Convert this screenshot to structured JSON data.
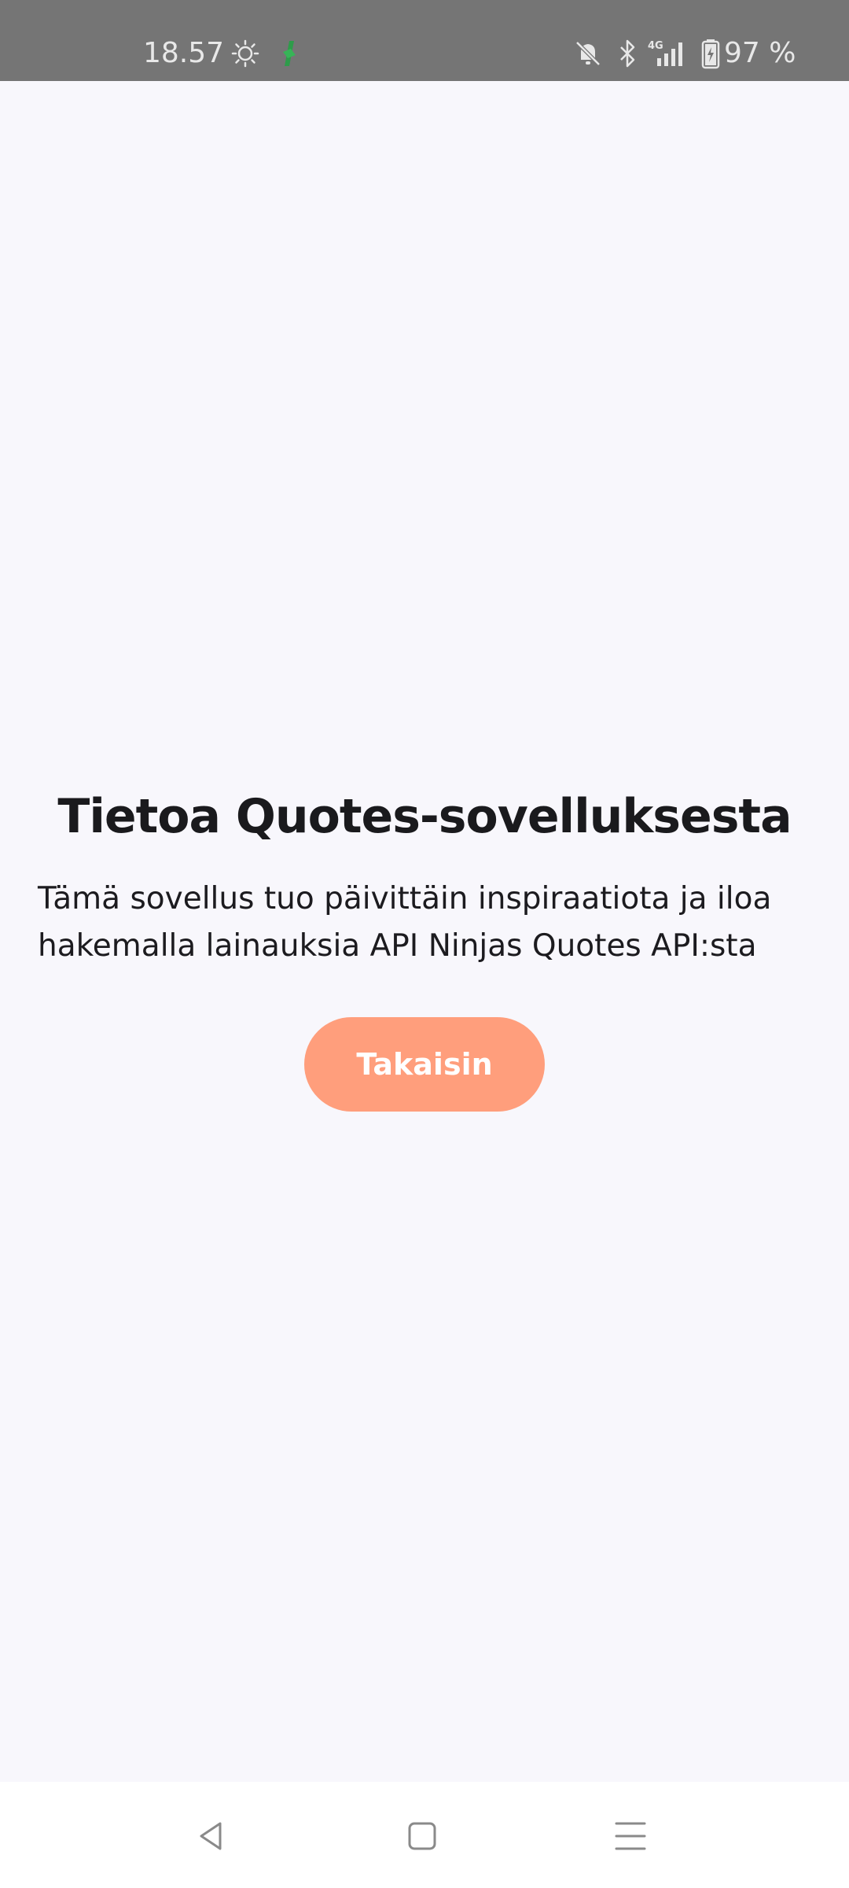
{
  "status_bar": {
    "time": "18.57",
    "battery_text": "97 %",
    "icons": [
      "brightness-icon",
      "app-notification-icon",
      "mute-icon",
      "bluetooth-icon",
      "signal-4g-icon",
      "battery-icon"
    ],
    "network_label": "4G"
  },
  "main": {
    "title": "Tietoa Quotes-sovelluksesta",
    "description": "Tämä sovellus tuo päivittäin inspiraatiota ja iloa hakemalla lainauksia API Ninjas Quotes API:sta",
    "back_button_label": "Takaisin"
  },
  "nav_bar": {
    "icons": [
      "back-icon",
      "home-icon",
      "menu-icon"
    ]
  },
  "colors": {
    "status_bar_bg": "#757575",
    "background": "#f8f7fc",
    "button_bg": "#ff9e7c",
    "button_text": "#ffffff",
    "title_text": "#1a1a1d",
    "app_icon_green": "#2e9c4a"
  }
}
